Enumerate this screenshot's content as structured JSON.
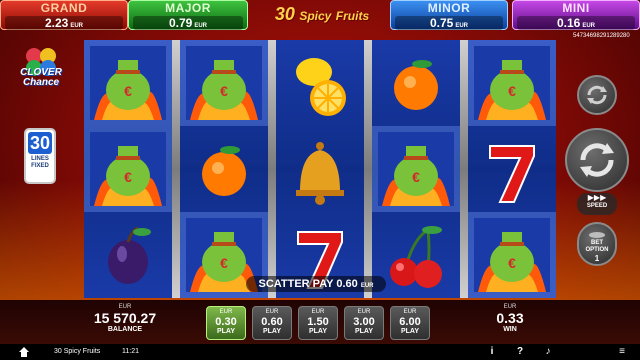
{
  "jackpots": {
    "grand": {
      "name": "GRAND",
      "value": "2.23",
      "currency": "EUR"
    },
    "major": {
      "name": "MAJOR",
      "value": "0.79",
      "currency": "EUR"
    },
    "minor": {
      "name": "MINOR",
      "value": "0.75",
      "currency": "EUR"
    },
    "mini": {
      "name": "MINI",
      "value": "0.16",
      "currency": "EUR"
    }
  },
  "logo": {
    "number": "30",
    "word": "Spicy",
    "word2": "Fruits"
  },
  "ticket_id": "54734698291289280",
  "clover": {
    "line1": "CLOVER",
    "line2": "Chance"
  },
  "lines": {
    "count": "30",
    "label1": "LINES",
    "label2": "FIXED"
  },
  "reels": [
    [
      "money-bag",
      "money-bag",
      "plum"
    ],
    [
      "money-bag",
      "orange",
      "money-bag"
    ],
    [
      "lemon",
      "bell",
      "seven"
    ],
    [
      "orange",
      "money-bag",
      "cherries"
    ],
    [
      "money-bag",
      "seven",
      "money-bag"
    ]
  ],
  "scatter": {
    "label": "SCATTER PAY",
    "value": "0.60",
    "currency": "EUR"
  },
  "controls": {
    "speed": "SPEED",
    "bet_option_line1": "BET",
    "bet_option_line2": "OPTION",
    "bet_option_value": "1"
  },
  "balance": {
    "currency": "EUR",
    "value": "15 570.27",
    "label": "BALANCE"
  },
  "bets": [
    {
      "currency": "EUR",
      "value": "0.30",
      "label": "PLAY",
      "selected": true
    },
    {
      "currency": "EUR",
      "value": "0.60",
      "label": "PLAY"
    },
    {
      "currency": "EUR",
      "value": "1.50",
      "label": "PLAY"
    },
    {
      "currency": "EUR",
      "value": "3.00",
      "label": "PLAY"
    },
    {
      "currency": "EUR",
      "value": "6.00",
      "label": "PLAY"
    }
  ],
  "win": {
    "currency": "EUR",
    "value": "0.33",
    "label": "WIN"
  },
  "status": {
    "title": "30 Spicy Fruits",
    "clock": "11:21",
    "info": "i",
    "help": "?",
    "sound": "♪",
    "menu": "≡"
  },
  "colors": {
    "reel_bg": "#1a3aa8",
    "selected_bet": "#7fb84a",
    "grand": "#e43b2b",
    "major": "#3fc23f",
    "minor": "#3b8ff0",
    "mini": "#c548e6"
  }
}
